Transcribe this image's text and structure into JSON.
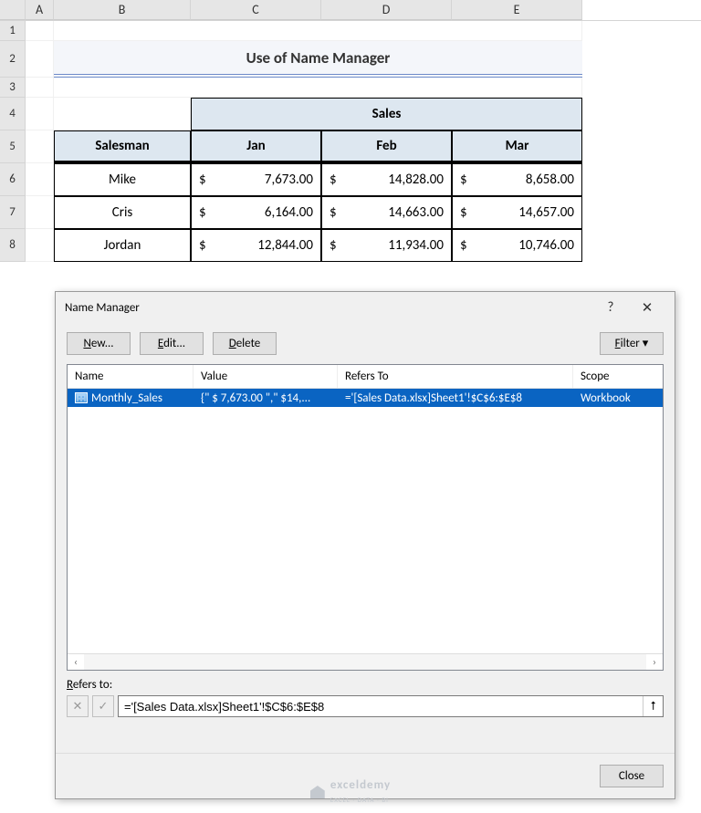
{
  "columns": {
    "A": "A",
    "B": "B",
    "C": "C",
    "D": "D",
    "E": "E"
  },
  "rows": {
    "1": "1",
    "2": "2",
    "3": "3",
    "4": "4",
    "5": "5",
    "6": "6",
    "7": "7",
    "8": "8"
  },
  "title": "Use of Name Manager",
  "headers": {
    "sales": "Sales",
    "salesman": "Salesman",
    "jan": "Jan",
    "feb": "Feb",
    "mar": "Mar"
  },
  "currency": "$",
  "data": [
    {
      "name": "Mike",
      "jan": "7,673.00",
      "feb": "14,828.00",
      "mar": "8,658.00"
    },
    {
      "name": "Cris",
      "jan": "6,164.00",
      "feb": "14,663.00",
      "mar": "14,657.00"
    },
    {
      "name": "Jordan",
      "jan": "12,844.00",
      "feb": "11,934.00",
      "mar": "10,746.00"
    }
  ],
  "dialog": {
    "title": "Name Manager",
    "help": "?",
    "close": "✕",
    "buttons": {
      "new": {
        "u": "N",
        "rest": "ew..."
      },
      "edit": {
        "u": "E",
        "rest": "dit..."
      },
      "delete": {
        "u": "D",
        "rest": "elete"
      },
      "filter": {
        "u": "F",
        "rest": "ilter",
        "arrow": "▾"
      },
      "close_btn": "Close"
    },
    "list": {
      "headers": {
        "name": "Name",
        "value": "Value",
        "refers": "Refers To",
        "scope": "Scope"
      },
      "row": {
        "name": "Monthly_Sales",
        "value": "{\" $ 7,673.00 \",\" $14,...",
        "refers": "='[Sales Data.xlsx]Sheet1'!$C$6:$E$8",
        "scope": "Workbook"
      }
    },
    "refers_label": {
      "u": "R",
      "rest": "efers to:"
    },
    "refers_value": "='[Sales Data.xlsx]Sheet1'!$C$6:$E$8",
    "scroll": {
      "left": "‹",
      "right": "›"
    },
    "cancel_icon": "✕",
    "confirm_icon": "✓",
    "picker_icon": "⭡"
  },
  "watermark": {
    "text": "exceldemy",
    "sub": "EXCEL · DATA · BI"
  }
}
